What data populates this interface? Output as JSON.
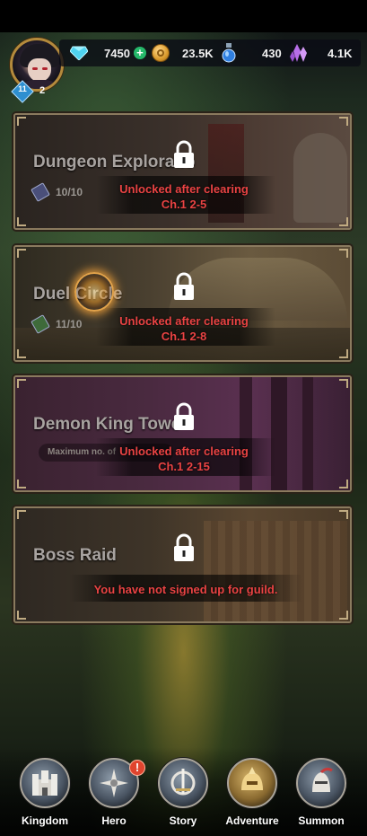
{
  "player": {
    "level": "11",
    "count": "2"
  },
  "resources": [
    {
      "name": "gems",
      "value": "7450",
      "icon": "diamond-icon"
    },
    {
      "name": "gold",
      "value": "23.5K",
      "icon": "coin-icon"
    },
    {
      "name": "potion",
      "value": "430",
      "icon": "potion-icon"
    },
    {
      "name": "crystal",
      "value": "4.1K",
      "icon": "crystal-icon"
    }
  ],
  "dungeons": [
    {
      "title": "Dungeon Exploratio",
      "ticket": "10/10",
      "lock_line1": "Unlocked after clearing",
      "lock_line2": "Ch.1 2-5"
    },
    {
      "title": "Duel Circle",
      "ticket": "11/10",
      "lock_line1": "Unlocked after clearing",
      "lock_line2": "Ch.1 2-8"
    },
    {
      "title": "Demon King Towe",
      "info": "Maximum no. of",
      "lock_line1": "Unlocked after clearing",
      "lock_line2": "Ch.1 2-15"
    },
    {
      "title": "Boss Raid",
      "lock_line1": "You have not signed up for guild."
    }
  ],
  "nav": [
    {
      "label": "Kingdom",
      "icon": "castle-icon"
    },
    {
      "label": "Hero",
      "icon": "compass-icon",
      "badge": "!"
    },
    {
      "label": "Story",
      "icon": "sword-icon"
    },
    {
      "label": "Adventure",
      "icon": "helmet-icon"
    },
    {
      "label": "Summon",
      "icon": "knight-helm-icon"
    }
  ],
  "colors": {
    "lock_text": "#e94343",
    "frame": "#8a7a5e",
    "gem": "#4fd3f0",
    "plus": "#25b86a"
  }
}
